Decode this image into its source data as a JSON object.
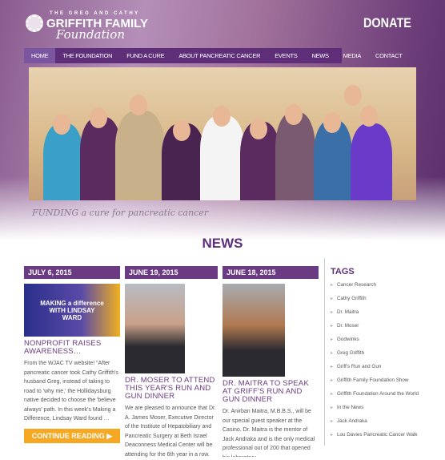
{
  "header": {
    "logo_small": "THE GREG AND CATHY",
    "logo_big": "GRIFFITH FAMILY",
    "logo_script": "Foundation",
    "donate": "DONATE"
  },
  "nav": [
    "HOME",
    "THE FOUNDATION",
    "FUND A CURE",
    "ABOUT PANCREATIC CANCER",
    "EVENTS",
    "NEWS",
    "MEDIA",
    "CONTACT"
  ],
  "tagline": "FUNDING a cure for pancreatic cancer",
  "news_heading": "NEWS",
  "posts": [
    {
      "date": "JULY 6, 2015",
      "image_text": "MAKING a difference WITH LINDSAY WARD",
      "title": "NONPROFIT RAISES AWARENESS…",
      "body": "From the WJAC TV website! \"After pancreatic cancer took Cathy Griffith's husband Greg, instead of taking to road to 'why me,' the Hollidaysburg native decided to choose the 'believe always' path. In this week's Making a Difference, Lindsay Ward found …",
      "button": "CONTINUE READING ▶"
    },
    {
      "date": "JUNE 19, 2015",
      "title": "DR. MOSER TO ATTEND THIS YEAR'S RUN AND GUN DINNER",
      "body": "We are pleased to announce that Dr. A. James Moser, Executive Director of the Institute of Hepatobiliary and Pancreatic Surgery at Beth Israel Deaconness Medical Center will be attending for the 6th year in a row."
    },
    {
      "date": "JUNE 18, 2015",
      "title": "DR. MAITRA TO SPEAK AT GRIFF'S RUN AND GUN DINNER",
      "body": "Dr. Anirban Maitra, M.B.B.S., will be our special guest speaker at the Casino. Dr. Maitra is the mentor of Jack Andraka and is the only medical professional out of 200 that opened his laboratory"
    }
  ],
  "tags": {
    "heading": "TAGS",
    "items": [
      "Cancer Research",
      "Cathy Griffith",
      "Dr. Maitra",
      "Dr. Moser",
      "Godwinks",
      "Greg Griffith",
      "Griff's Run and Gun",
      "Griffith Family Foundation Show",
      "Griffith Foundation Around the World",
      "In the News",
      "Jack Andraka",
      "Lou Davies Pancreatic Cancer Walk"
    ]
  }
}
